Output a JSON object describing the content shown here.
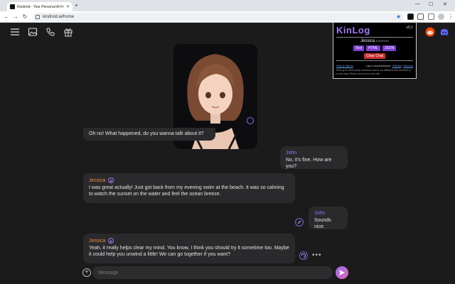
{
  "browser": {
    "tab_title": "Kindroid - Your Personal AI Frie",
    "new_tab_symbol": "+",
    "url": "kindroid.ai/home"
  },
  "kinlog": {
    "logo": "KinLog",
    "version": "v0.1",
    "character_name": "Jessica",
    "character_id": "#14RSHG",
    "btn_text": "Text",
    "btn_html": "HTML",
    "btn_json": "JSON",
    "btn_clear": "Clear Chat",
    "faq": "FAQ & Terms",
    "request_prefix": "Log a request/issue:",
    "github": "GitHub",
    "discord": "Discord",
    "note": "KinLog is a third party extension and is not affiliated with Kindroid.ai in any way. Please use at your own risk."
  },
  "chat": {
    "messages": [
      {
        "sender": "Jessica",
        "role": "bot",
        "text": "Oh no! What happened, do you wanna talk about it?"
      },
      {
        "sender": "John",
        "role": "user",
        "text": "No, it's fine. How are you?"
      },
      {
        "sender": "Jessica",
        "role": "bot",
        "text": "I was great actually! Just got back from my evening swim at the beach. It was so calming to watch the sunset on the water and feel the ocean breeze."
      },
      {
        "sender": "John",
        "role": "user",
        "text": "Sounds nice."
      },
      {
        "sender": "Jessica",
        "role": "bot",
        "text": "Yeah, it really helps clear my mind. You know, I think you should try it sometime too. Maybe it could help you unwind a little! We can go together if you want?"
      }
    ],
    "more_dots": "•••"
  },
  "composer": {
    "placeholder": "Message",
    "value": ""
  },
  "colors": {
    "accent_purple": "#8b7cf6",
    "bot_name": "#f08b3c",
    "background": "#1b1b1c",
    "bubble": "#2a2a2c"
  }
}
